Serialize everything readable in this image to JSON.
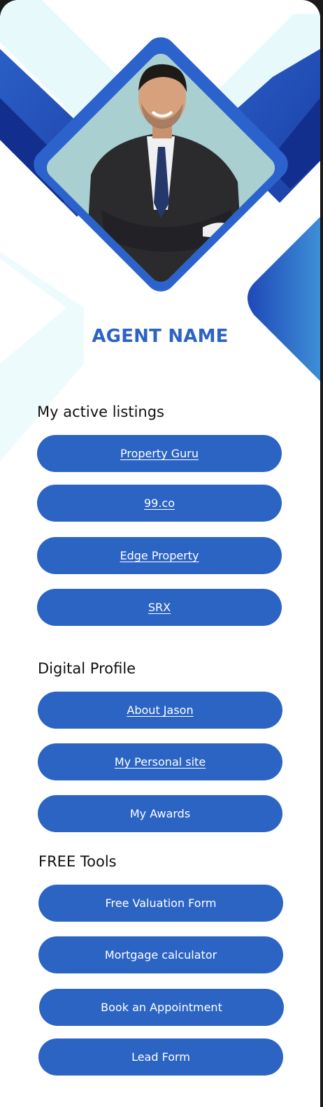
{
  "agent": {
    "name": "AGENT NAME"
  },
  "sections": {
    "listings": {
      "title": "My active listings"
    },
    "profile": {
      "title": "Digital Profile"
    },
    "tools": {
      "title": "FREE Tools"
    }
  },
  "buttons": {
    "listings": [
      "Property Guru",
      "99.co",
      "Edge Property",
      "SRX"
    ],
    "profile": [
      "About Jason",
      "My Personal site",
      "My Awards"
    ],
    "tools": [
      "Free Valuation Form",
      "Mortgage calculator",
      "Book an Appointment",
      "Lead Form"
    ]
  },
  "colors": {
    "accent": "#2c64c4",
    "name": "#2c63c5",
    "dark_blue": "#13318f",
    "light_cyan": "#e6f8fb"
  },
  "icons": {
    "photo": "agent-portrait"
  }
}
